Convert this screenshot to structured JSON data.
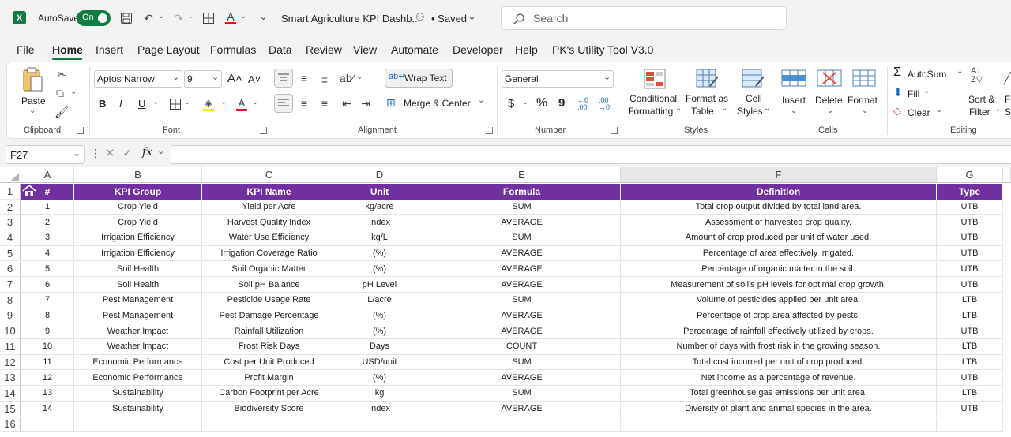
{
  "titlebar": {
    "autosave_label": "AutoSave",
    "toggle_label": "On",
    "file_title": "Smart Agriculture KPI Dashb...",
    "saved_status": "• Saved",
    "search_placeholder": "Search"
  },
  "menu": [
    "File",
    "Home",
    "Insert",
    "Page Layout",
    "Formulas",
    "Data",
    "Review",
    "View",
    "Automate",
    "Developer",
    "Help",
    "PK's Utility Tool V3.0"
  ],
  "ribbon": {
    "paste": "Paste",
    "clipboard": "Clipboard",
    "font_name": "Aptos Narrow",
    "font_size": "9",
    "font": "Font",
    "wrap_text": "Wrap Text",
    "merge_center": "Merge & Center",
    "alignment": "Alignment",
    "number_format": "General",
    "number": "Number",
    "conditional_1": "Conditional",
    "conditional_2": "Formatting",
    "format_as_1": "Format as",
    "format_as_2": "Table",
    "cell_styles_1": "Cell",
    "cell_styles_2": "Styles",
    "styles": "Styles",
    "insert": "Insert",
    "delete": "Delete",
    "format": "Format",
    "cells": "Cells",
    "autosum": "AutoSum",
    "fill": "Fill",
    "clear": "Clear",
    "sort_1": "Sort &",
    "sort_2": "Filter",
    "find_1": "Fi",
    "find_2": "Se",
    "editing": "Editing",
    "bold": "B",
    "italic": "I",
    "underline": "U",
    "dollar": "$",
    "percent": "%",
    "comma": "9"
  },
  "formula_bar": {
    "name_box": "F27",
    "fx": "fx",
    "value": ""
  },
  "columns": [
    "A",
    "B",
    "C",
    "D",
    "E",
    "F",
    "G"
  ],
  "headers": [
    "#",
    "KPI Group",
    "KPI Name",
    "Unit",
    "Formula",
    "Definition",
    "Type"
  ],
  "rows": [
    [
      "1",
      "Crop Yield",
      "Yield per Acre",
      "kg/acre",
      "SUM",
      "Total crop output divided by total land area.",
      "UTB"
    ],
    [
      "2",
      "Crop Yield",
      "Harvest Quality Index",
      "Index",
      "AVERAGE",
      "Assessment of harvested crop quality.",
      "UTB"
    ],
    [
      "3",
      "Irrigation Efficiency",
      "Water Use Efficiency",
      "kg/L",
      "SUM",
      "Amount of crop produced per unit of water used.",
      "UTB"
    ],
    [
      "4",
      "Irrigation Efficiency",
      "Irrigation Coverage Ratio",
      "(%)",
      "AVERAGE",
      "Percentage of area effectively irrigated.",
      "UTB"
    ],
    [
      "5",
      "Soil Health",
      "Soil Organic Matter",
      "(%)",
      "AVERAGE",
      "Percentage of organic matter in the soil.",
      "UTB"
    ],
    [
      "6",
      "Soil Health",
      "Soil pH Balance",
      "pH Level",
      "AVERAGE",
      "Measurement of soil's pH levels for optimal crop growth.",
      "UTB"
    ],
    [
      "7",
      "Pest Management",
      "Pesticide Usage Rate",
      "L/acre",
      "SUM",
      "Volume of pesticides applied per unit area.",
      "LTB"
    ],
    [
      "8",
      "Pest Management",
      "Pest Damage Percentage",
      "(%)",
      "AVERAGE",
      "Percentage of crop area affected by pests.",
      "LTB"
    ],
    [
      "9",
      "Weather Impact",
      "Rainfall Utilization",
      "(%)",
      "AVERAGE",
      "Percentage of rainfall effectively utilized by crops.",
      "UTB"
    ],
    [
      "10",
      "Weather Impact",
      "Frost Risk Days",
      "Days",
      "COUNT",
      "Number of days with frost risk in the growing season.",
      "LTB"
    ],
    [
      "11",
      "Economic Performance",
      "Cost per Unit Produced",
      "USD/unit",
      "SUM",
      "Total cost incurred per unit of crop produced.",
      "LTB"
    ],
    [
      "12",
      "Economic Performance",
      "Profit Margin",
      "(%)",
      "AVERAGE",
      "Net income as a percentage of revenue.",
      "UTB"
    ],
    [
      "13",
      "Sustainability",
      "Carbon Footprint per Acre",
      "kg",
      "SUM",
      "Total greenhouse gas emissions per unit area.",
      "LTB"
    ],
    [
      "14",
      "Sustainability",
      "Biodiversity Score",
      "Index",
      "AVERAGE",
      "Diversity of plant and animal species in the area.",
      "UTB"
    ]
  ],
  "row_numbers": [
    "1",
    "2",
    "3",
    "4",
    "5",
    "6",
    "7",
    "8",
    "9",
    "10",
    "11",
    "12",
    "13",
    "14",
    "15",
    "16"
  ],
  "colors": {
    "header_fill": "#7030a0",
    "excel_green": "#107c41"
  }
}
